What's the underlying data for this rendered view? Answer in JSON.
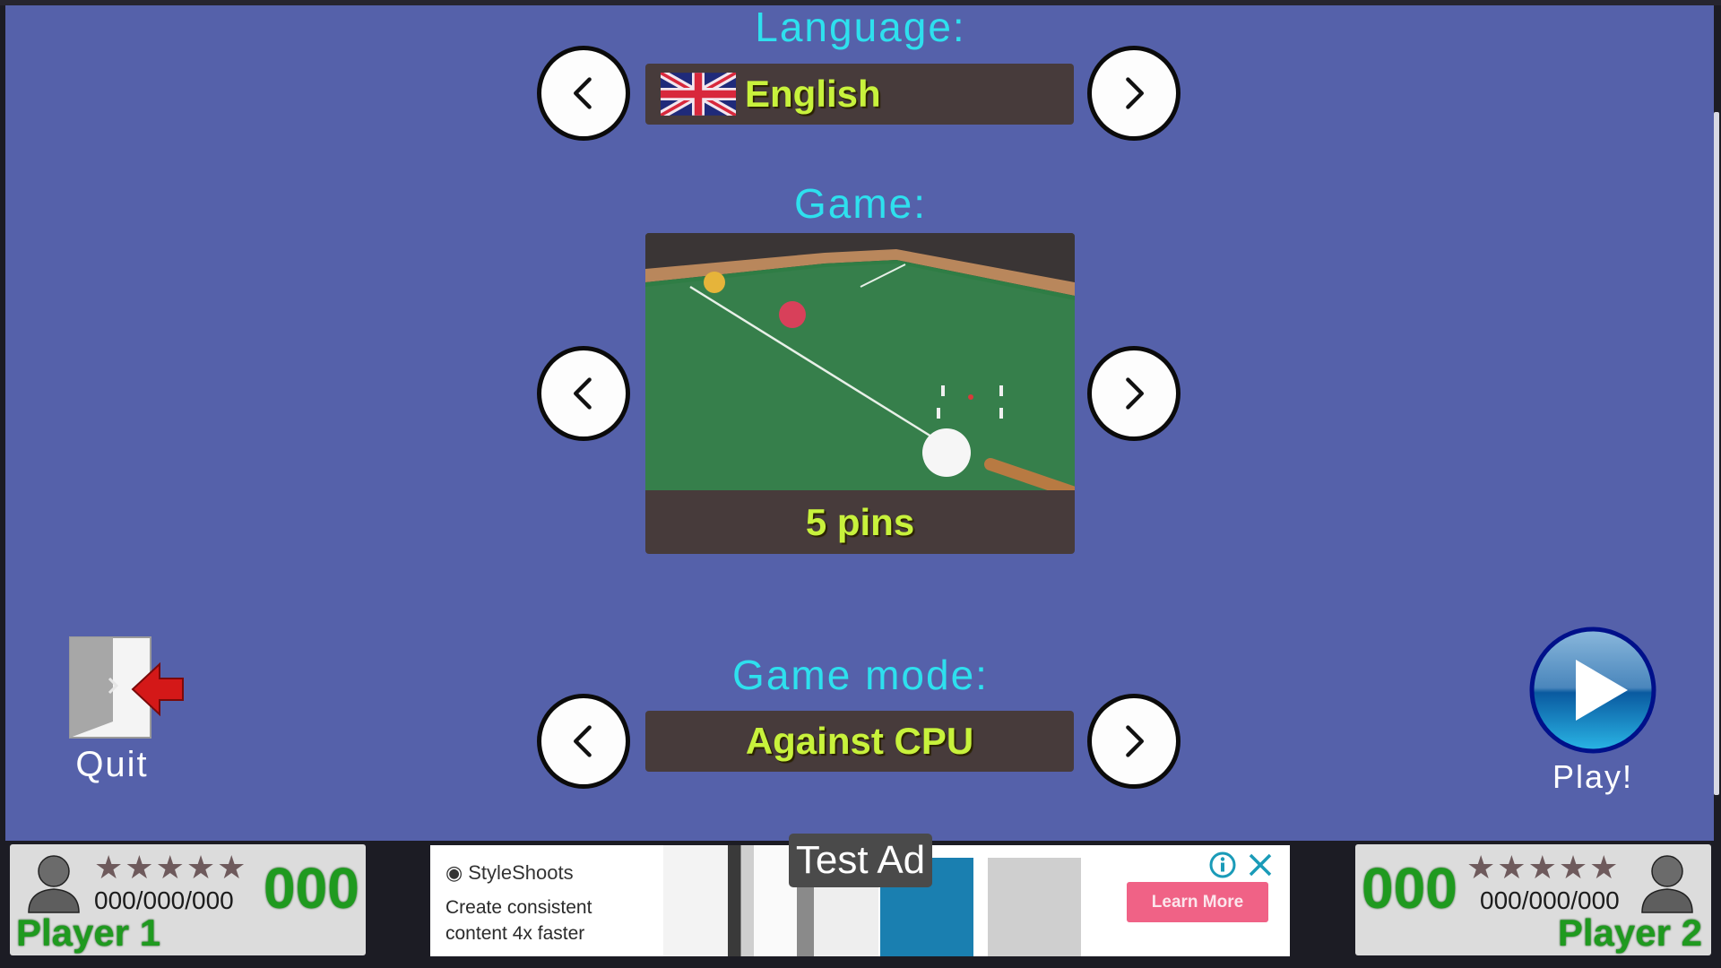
{
  "language": {
    "label": "Language:",
    "value": "English",
    "flag_icon": "uk-flag-icon"
  },
  "game": {
    "label": "Game:",
    "value": "5 pins"
  },
  "game_mode": {
    "label": "Game mode:",
    "value": "Against CPU"
  },
  "quit": {
    "label": "Quit"
  },
  "play": {
    "label": "Play!"
  },
  "player1": {
    "name": "Player 1",
    "score": "000",
    "stats": "000/000/000",
    "stars": 5
  },
  "player2": {
    "name": "Player 2",
    "score": "000",
    "stats": "000/000/000",
    "stars": 5
  },
  "ad": {
    "badge": "Test Ad",
    "brand": "StyleShoots",
    "copy_line1": "Create consistent",
    "copy_line2": "content 4x faster",
    "cta": "Learn More"
  },
  "colors": {
    "background": "#5561aa",
    "label_cyan": "#2ee0ee",
    "value_yellow": "#c8f23c",
    "value_box": "#473b3b",
    "player_green": "#1f9a1f",
    "ad_cta": "#f06286"
  }
}
